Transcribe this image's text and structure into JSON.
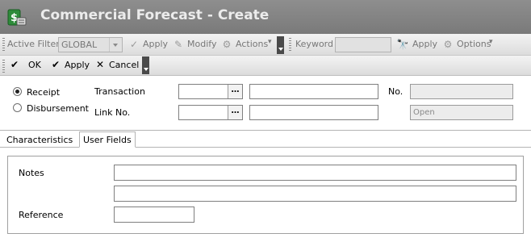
{
  "window": {
    "title": "Commercial Forecast - Create",
    "app_icon": "cash-dollar-icon"
  },
  "toolbar": {
    "active_filter_label": "Active Filter",
    "filter_value": "GLOBAL",
    "apply_label": "Apply",
    "modify_label": "Modify",
    "actions_label": "Actions",
    "keyword_label": "Keyword",
    "keyword_value": "",
    "keyword_apply_label": "Apply",
    "options_label": "Options"
  },
  "actions_bar": {
    "ok_label": "OK",
    "apply_label": "Apply",
    "cancel_label": "Cancel"
  },
  "form": {
    "radio_receipt": "Receipt",
    "radio_disbursement": "Disbursement",
    "selected": "Receipt",
    "transaction_label": "Transaction",
    "link_label": "Link No.",
    "no_label": "No.",
    "no_value": "",
    "status_value": "Open",
    "ellipsis": "…"
  },
  "tabs": [
    {
      "label": "Characteristics",
      "active": false
    },
    {
      "label": "User Fields",
      "active": true
    }
  ],
  "user_fields": {
    "notes_label": "Notes",
    "reference_label": "Reference"
  },
  "colors": {
    "titlebar": "#7f7f7f",
    "title_text": "#ececec",
    "icon_green": "#2e8b3a"
  }
}
